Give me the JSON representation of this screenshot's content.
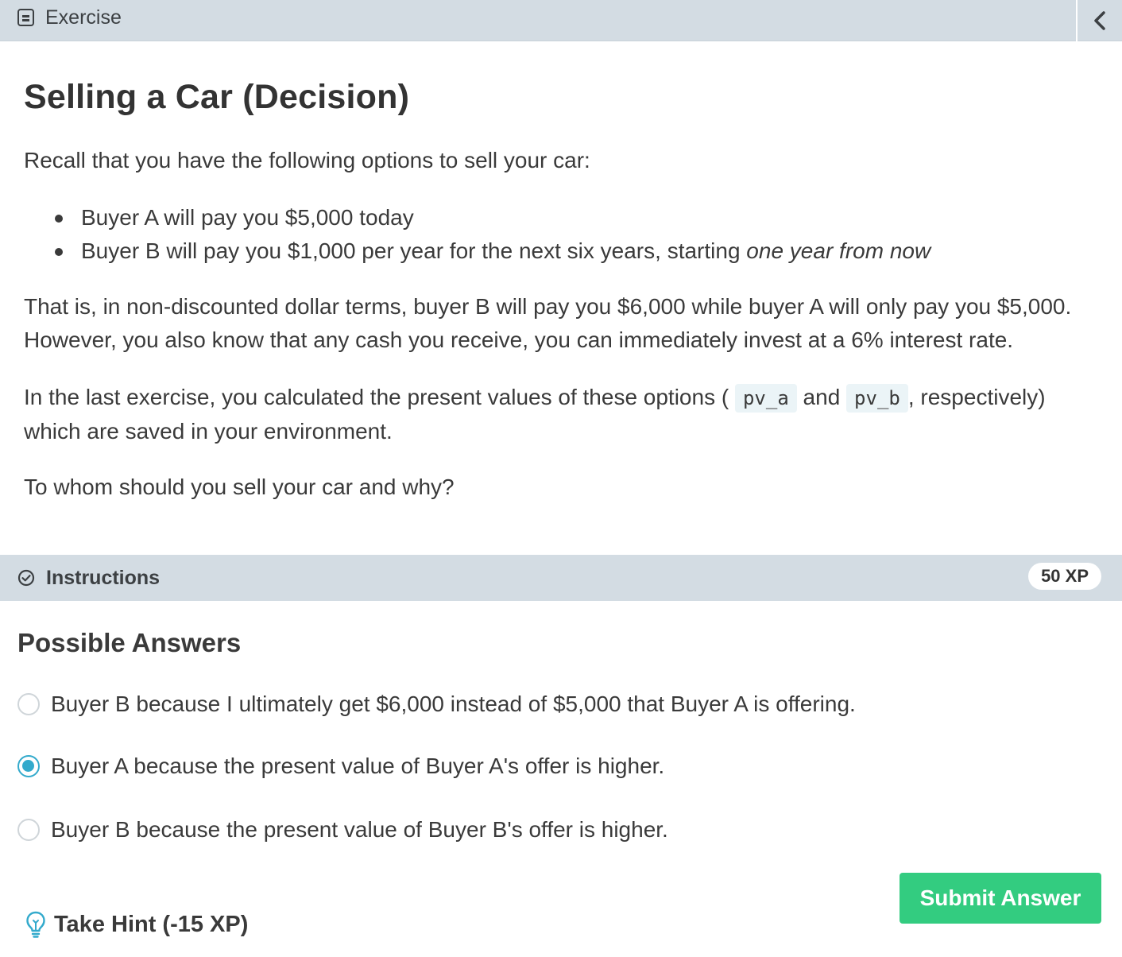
{
  "header": {
    "title": "Exercise",
    "icons": {
      "exercise": "document-icon",
      "collapse": "chevron-left-icon"
    }
  },
  "exercise": {
    "title": "Selling a Car (Decision)",
    "intro": "Recall that you have the following options to sell your car:",
    "options": [
      "Buyer A will pay you $5,000 today",
      "Buyer B will pay you $1,000 per year for the next six years, starting "
    ],
    "option2_emphasis": "one year from now",
    "para2_line1": "That is, in non-discounted dollar terms, buyer B will pay you $6,000 while buyer A will only pay you $5,000.",
    "para2_line2": "However, you also know that any cash you receive, you can immediately invest at a 6% interest rate.",
    "para3_pre": "In the last exercise, you calculated the present values of these options (",
    "code_a": "pv_a",
    "para3_and": "and",
    "code_b": "pv_b",
    "para3_post": ", respectively)",
    "para3_line2": "which are saved in your environment.",
    "question": "To whom should you sell your car and why?"
  },
  "instructions": {
    "label": "Instructions",
    "xp": "50 XP",
    "icon": "check-circle-icon"
  },
  "answers": {
    "title": "Possible Answers",
    "options": [
      {
        "label": "Buyer B because I ultimately get $6,000 instead of $5,000 that Buyer A is offering.",
        "selected": false
      },
      {
        "label": "Buyer A because the present value of Buyer A's offer is higher.",
        "selected": true
      },
      {
        "label": "Buyer B because the present value of Buyer B's offer is higher.",
        "selected": false
      }
    ]
  },
  "actions": {
    "hint": "Take Hint (-15 XP)",
    "hint_icon": "lightbulb-icon",
    "submit": "Submit Answer"
  },
  "colors": {
    "header_bg": "#d3dce3",
    "accent_radio": "#33aacc",
    "submit_green": "#33cc80",
    "code_bg": "#ebf4f7"
  }
}
